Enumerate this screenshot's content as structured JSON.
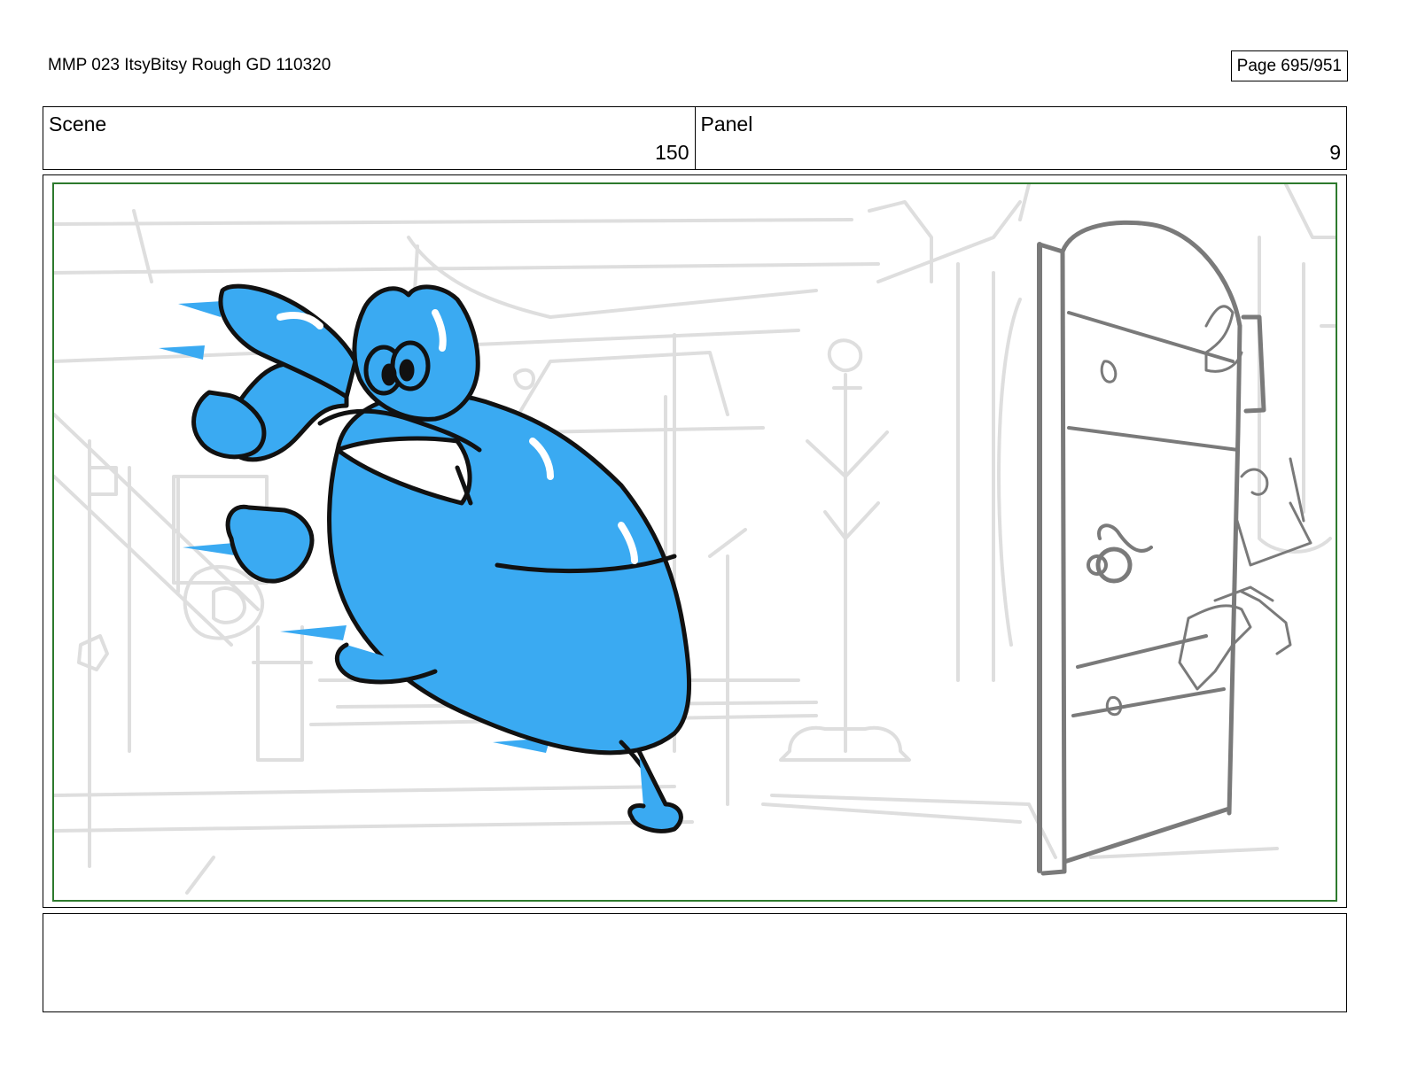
{
  "document": {
    "title": "MMP 023 ItsyBitsy Rough GD 110320",
    "page": "Page 695/951"
  },
  "header": {
    "scene_label": "Scene",
    "scene_number": "150",
    "panel_label": "Panel",
    "panel_number": "9"
  },
  "artwork": {
    "character_color": "#3aaaf2",
    "background_line_color": "#dedede",
    "door_line_color": "#7a7a7a",
    "frame_color": "#2d7a2d"
  },
  "notes": {
    "text": ""
  }
}
